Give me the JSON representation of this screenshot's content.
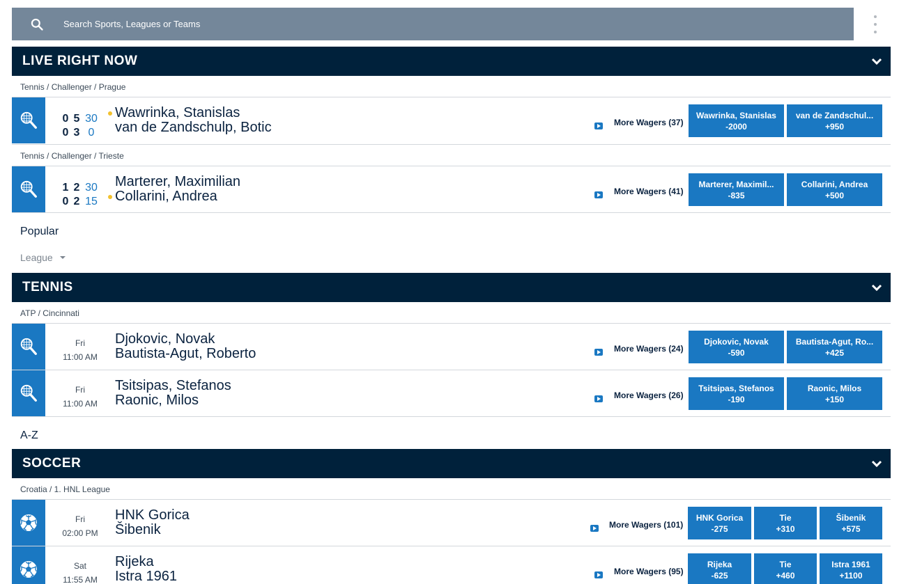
{
  "search": {
    "placeholder": "Search Sports, Leagues or Teams"
  },
  "colors": {
    "header_bg": "#00213b",
    "accent": "#1a78c2",
    "search_bg": "#74879a",
    "serve_dot": "#f2c12e"
  },
  "live": {
    "title": "LIVE RIGHT NOW",
    "events": [
      {
        "breadcrumb": "Tennis / Challenger / Prague",
        "icon": "tennis-racket-icon",
        "score_home": [
          "0",
          "5",
          "30"
        ],
        "score_away": [
          "0",
          "3",
          "0"
        ],
        "team_home": "Wawrinka, Stanislas",
        "team_away": "van de Zandschulp, Botic",
        "serving": "home",
        "more": "More Wagers (37)",
        "odds": [
          {
            "name": "Wawrinka, Stanislas",
            "price": "-2000"
          },
          {
            "name": "van de Zandschul...",
            "price": "+950"
          }
        ]
      },
      {
        "breadcrumb": "Tennis / Challenger / Trieste",
        "icon": "tennis-racket-icon",
        "score_home": [
          "1",
          "2",
          "30"
        ],
        "score_away": [
          "0",
          "2",
          "15"
        ],
        "team_home": "Marterer, Maximilian",
        "team_away": "Collarini, Andrea",
        "serving": "away",
        "more": "More Wagers (41)",
        "odds": [
          {
            "name": "Marterer, Maximil...",
            "price": "-835"
          },
          {
            "name": "Collarini, Andrea",
            "price": "+500"
          }
        ]
      }
    ]
  },
  "popular": {
    "label": "Popular",
    "league_select": "League"
  },
  "tennis": {
    "title": "TENNIS",
    "breadcrumb": "ATP / Cincinnati",
    "events": [
      {
        "day": "Fri",
        "time": "11:00 AM",
        "team_home": "Djokovic, Novak",
        "team_away": "Bautista-Agut, Roberto",
        "more": "More Wagers (24)",
        "odds": [
          {
            "name": "Djokovic, Novak",
            "price": "-590"
          },
          {
            "name": "Bautista-Agut, Ro...",
            "price": "+425"
          }
        ]
      },
      {
        "day": "Fri",
        "time": "11:00 AM",
        "team_home": "Tsitsipas, Stefanos",
        "team_away": "Raonic, Milos",
        "more": "More Wagers (26)",
        "odds": [
          {
            "name": "Tsitsipas, Stefanos",
            "price": "-190"
          },
          {
            "name": "Raonic, Milos",
            "price": "+150"
          }
        ]
      }
    ]
  },
  "az": {
    "label": "A-Z"
  },
  "soccer": {
    "title": "SOCCER",
    "breadcrumb": "Croatia / 1. HNL League",
    "events": [
      {
        "day": "Fri",
        "time": "02:00 PM",
        "team_home": "HNK Gorica",
        "team_away": "Šibenik",
        "more": "More Wagers (101)",
        "odds": [
          {
            "name": "HNK Gorica",
            "price": "-275"
          },
          {
            "name": "Tie",
            "price": "+310"
          },
          {
            "name": "Šibenik",
            "price": "+575"
          }
        ]
      },
      {
        "day": "Sat",
        "time": "11:55 AM",
        "team_home": "Rijeka",
        "team_away": "Istra 1961",
        "more": "More Wagers (95)",
        "odds": [
          {
            "name": "Rijeka",
            "price": "-625"
          },
          {
            "name": "Tie",
            "price": "+460"
          },
          {
            "name": "Istra 1961",
            "price": "+1100"
          }
        ]
      }
    ]
  }
}
